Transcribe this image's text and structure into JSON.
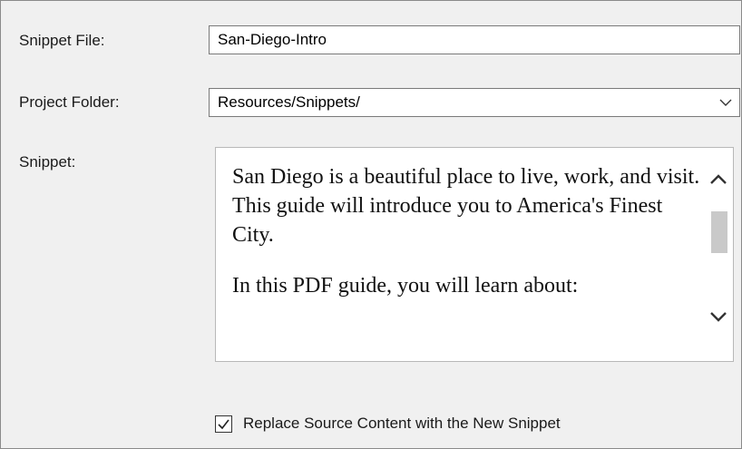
{
  "fields": {
    "snippet_file": {
      "label": "Snippet File:",
      "value": "San-Diego-Intro"
    },
    "project_folder": {
      "label": "Project Folder:",
      "value": "Resources/Snippets/"
    },
    "snippet": {
      "label": "Snippet:",
      "paragraphs": [
        "San Diego is a beautiful place to live, work, and visit. This guide will introduce you to America's Finest City.",
        "In this PDF guide, you will learn about:"
      ]
    }
  },
  "options": {
    "replace_source": {
      "label": "Replace Source Content with the New Snippet",
      "checked": true
    }
  },
  "icons": {
    "dropdown": "chevron-down-icon",
    "scroll_up": "chevron-up-icon",
    "scroll_down": "chevron-down-icon",
    "checkbox": "checkmark-icon"
  }
}
